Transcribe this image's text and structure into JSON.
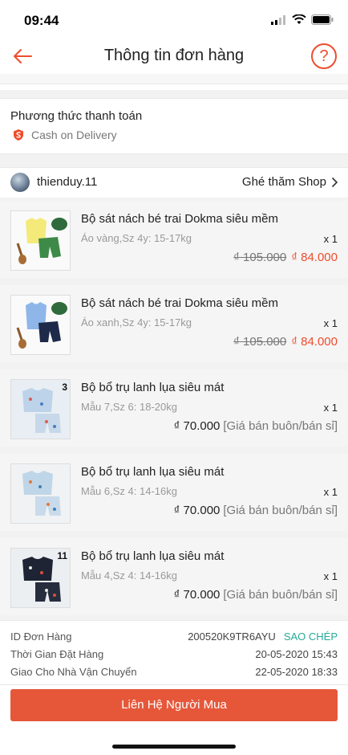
{
  "status_bar": {
    "time": "09:44"
  },
  "nav": {
    "title": "Thông tin đơn hàng",
    "help_label": "?"
  },
  "payment": {
    "title": "Phương thức thanh toán",
    "method": "Cash on Delivery"
  },
  "shop": {
    "name": "thienduy.11",
    "visit_label": "Ghé thăm Shop"
  },
  "products": [
    {
      "name": "Bộ sát nách bé trai Dokma siêu mềm",
      "variant": "Áo vàng,Sz 4y: 15-17kg",
      "qty": "x 1",
      "old_price": "₫ 105.000",
      "price": "₫ 84.000",
      "note": "",
      "badge": ""
    },
    {
      "name": "Bộ sát nách bé trai Dokma siêu mềm",
      "variant": "Áo xanh,Sz 4y: 15-17kg",
      "qty": "x 1",
      "old_price": "₫ 105.000",
      "price": "₫ 84.000",
      "note": "",
      "badge": ""
    },
    {
      "name": "Bộ bổ trụ lanh lụa siêu mát",
      "variant": "Mẫu 7,Sz 6: 18-20kg",
      "qty": "x 1",
      "old_price": "",
      "price": "₫ 70.000",
      "note": "[Giá bán buôn/bán sỉ]",
      "badge": "3"
    },
    {
      "name": "Bộ bổ trụ lanh lụa siêu mát",
      "variant": "Mẫu 6,Sz 4: 14-16kg",
      "qty": "x 1",
      "old_price": "",
      "price": "₫ 70.000",
      "note": "[Giá bán buôn/bán sỉ]",
      "badge": ""
    },
    {
      "name": "Bộ bổ trụ lanh lụa siêu mát",
      "variant": "Mẫu 4,Sz 4: 14-16kg",
      "qty": "x 1",
      "old_price": "",
      "price": "₫ 70.000",
      "note": "[Giá bán buôn/bán sỉ]",
      "badge": "11"
    }
  ],
  "order_info": {
    "id_label": "ID Đơn Hàng",
    "id_value": "200520K9TR6AYU",
    "copy_label": "SAO CHÉP",
    "order_time_label": "Thời Gian Đặt Hàng",
    "order_time_value": "20-05-2020 15:43",
    "ship_label": "Giao Cho Nhà Vận Chuyển",
    "ship_value": "22-05-2020 18:33"
  },
  "footer": {
    "contact_label": "Liên Hệ Người Mua"
  },
  "colors": {
    "accent": "#ee4d2d",
    "button": "#e6573a",
    "copy": "#26aa99"
  }
}
